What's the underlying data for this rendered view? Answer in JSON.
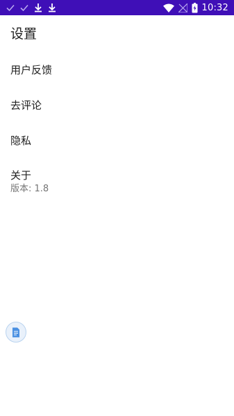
{
  "status_bar": {
    "time": "10:32",
    "background": "#3f0fb7",
    "left_icons": [
      "check-icon",
      "check-icon",
      "download-icon",
      "download-icon"
    ],
    "right_icons": [
      "wifi-icon",
      "no-signal-icon",
      "battery-charging-icon"
    ]
  },
  "page": {
    "title": "设置"
  },
  "settings": {
    "items": [
      {
        "label": "用户反馈"
      },
      {
        "label": "去评论"
      },
      {
        "label": "隐私"
      },
      {
        "label": "关于",
        "summary": "版本: 1.8"
      }
    ]
  },
  "fab": {
    "icon": "document-icon",
    "accent": "#4a90e2"
  }
}
